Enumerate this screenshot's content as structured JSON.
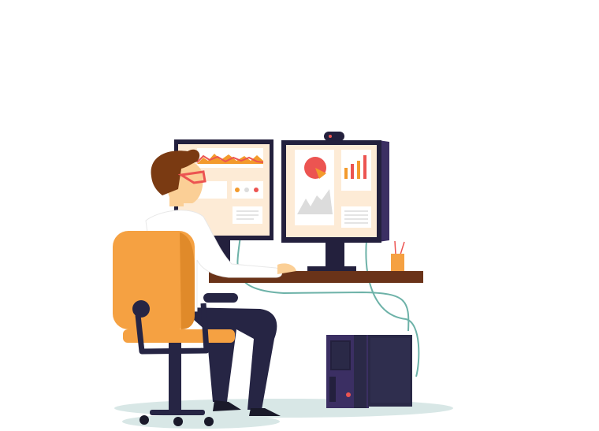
{
  "illustration": {
    "subject": "man working at desk with two monitors",
    "colors": {
      "background": "#ffffff",
      "monitor_frame": "#23203d",
      "monitor_side": "#3b2f63",
      "screen_bg": "#fdebd6",
      "panel": "#ffffff",
      "accent_red": "#ec5451",
      "accent_orange": "#f39a2c",
      "accent_gray": "#dcdcdc",
      "chair": "#f5a142",
      "chair_shade": "#e08a2a",
      "pants": "#262544",
      "desk": "#6a3319",
      "hair": "#7a3a12",
      "skin": "#fbcf96",
      "shirt": "#ffffff",
      "cable": "#6db2a8",
      "floor_shadow": "#d8e7e6",
      "pc_case": "#3b2f63",
      "pc_dark": "#2a2947"
    },
    "left_monitor": {
      "widgets": [
        "area-chart",
        "status-dots",
        "text-card"
      ]
    },
    "right_monitor": {
      "widgets": [
        "pie-chart",
        "mountain-chart",
        "bar-chart",
        "text-card"
      ],
      "bar_chart_relative_heights": [
        0.55,
        0.7,
        0.85,
        1.0
      ]
    }
  }
}
